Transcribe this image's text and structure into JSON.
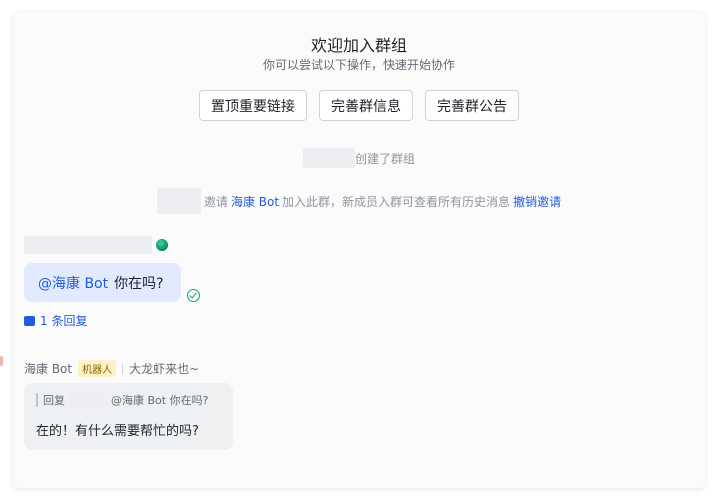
{
  "welcome": {
    "title": "欢迎加入群组",
    "subtitle": "你可以尝试以下操作，快速开始协作"
  },
  "actions": [
    {
      "label": "置顶重要链接"
    },
    {
      "label": "完善群信息"
    },
    {
      "label": "完善群公告"
    }
  ],
  "system": {
    "created_text": "创建了群组",
    "invite_verb": "邀请",
    "invite_target": "海康 Bot",
    "invite_text": "加入此群，新成员入群可查看所有历史消息",
    "revoke_label": "撤销邀请"
  },
  "user_message": {
    "mention": "@海康 Bot",
    "text": "你在吗?",
    "reply_count": "1 条回复"
  },
  "bot_message": {
    "sender": "海康 Bot",
    "tag": "机器人",
    "signature": "大龙虾来也~",
    "quote_prefix": "回复",
    "quote_text": "@海康 Bot 你在吗?",
    "text": "在的！有什么需要帮忙的吗?"
  },
  "colors": {
    "accent": "#245bdb",
    "user_bubble": "#e1eaff",
    "bot_bubble": "#eff0f1",
    "read": "#1aa07a"
  }
}
